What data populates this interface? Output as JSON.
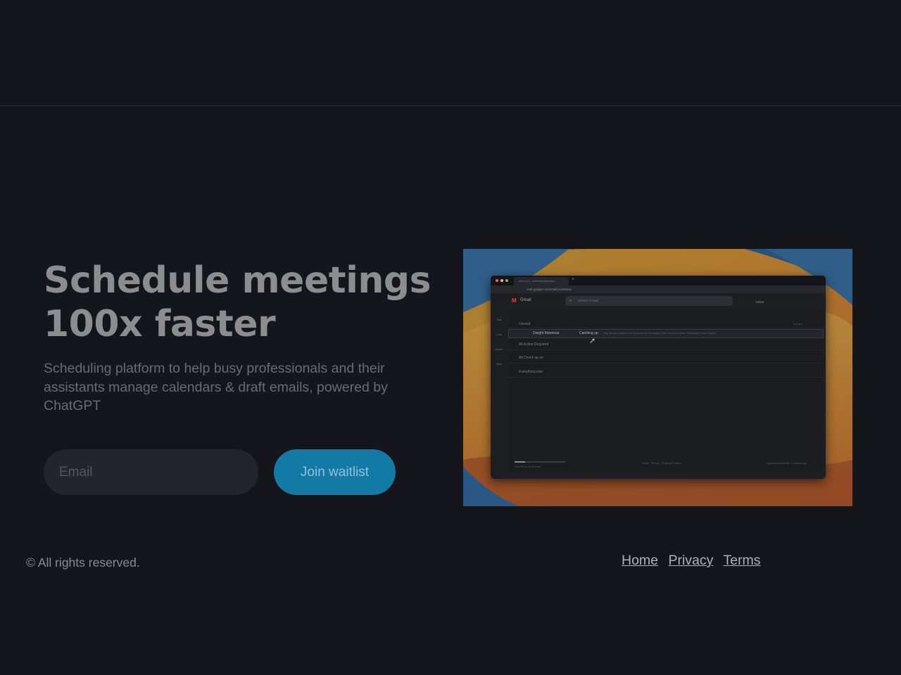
{
  "hero": {
    "title_line1": "Schedule meetings",
    "title_line2": "100x faster",
    "subtitle": "Scheduling platform to help busy professionals and their assistants manage calendars & draft emails, powered by ChatGPT"
  },
  "signup": {
    "email_placeholder": "Email",
    "email_value": "",
    "button_label": "Join waitlist"
  },
  "preview": {
    "tab_title": "Inbox (1) - scheduler@rocky...",
    "tab_plus": "+",
    "url": "mail.google.com/mail/u/1/#inbox",
    "app_name": "Gmail",
    "search_placeholder": "Search in mail",
    "status": "Active",
    "rail": [
      "Mail",
      "Chat",
      "Spaces",
      "Meet"
    ],
    "sections": [
      {
        "label": "Unread",
        "count": "1–1 of 1"
      },
      {
        "label": "All Action Required"
      },
      {
        "label": "All Check up on"
      },
      {
        "label": "Everything else"
      }
    ],
    "email_row": {
      "sender": "Dwight Manetour",
      "subject": "Catching up",
      "snippet": "- Hey Rocky! Would love to catch up this week. Free time for coffee Thursday? Best, Dwight"
    },
    "storage": "0.01 GB of 15 GB used",
    "footer_center": "Terms · Privacy · Program Policies",
    "footer_right": "Last account activity: 2 minutes ago"
  },
  "footer": {
    "copyright": "© All rights reserved.",
    "links": [
      "Home",
      "Privacy",
      "Terms"
    ]
  },
  "colors": {
    "background": "#15161c",
    "accent": "#137aa6",
    "headline": "#8c8c91"
  }
}
